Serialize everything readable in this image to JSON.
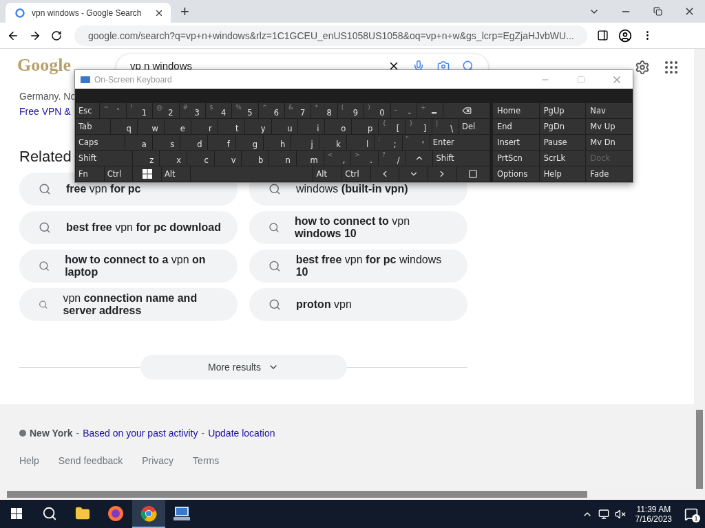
{
  "browser": {
    "tab": {
      "title": "vpn windows - Google Search",
      "selected": true
    },
    "new_tab": "+",
    "url": "google.com/search?q=vp+n+windows&rlz=1C1GCEU_enUS1058US1058&oq=vp+n+w&gs_lcrp=EgZjaHJvbWU..."
  },
  "google": {
    "logo": "Google",
    "query": "vp n windows"
  },
  "snippet": {
    "text": "Germany. No",
    "link": "Free VPN &"
  },
  "related": {
    "heading": "Related",
    "items": [
      {
        "text": "**free** vpn **for pc**"
      },
      {
        "text": "windows **(built-in vpn)**"
      },
      {
        "text": "**best free** vpn **for pc download**"
      },
      {
        "text": "**how to connect to** vpn **windows 10**"
      },
      {
        "text": "**how to connect to a** vpn **on laptop**"
      },
      {
        "text": "**best free** vpn **for pc** windows **10**"
      },
      {
        "text": "vpn **connection name and server address**"
      },
      {
        "text": "**proton** vpn"
      }
    ]
  },
  "more_results": "More results",
  "footer": {
    "location_line": [
      {
        "kind": "place",
        "text": "New York"
      },
      {
        "kind": "sep",
        "text": "-"
      },
      {
        "kind": "link",
        "text": "Based on your past activity"
      },
      {
        "kind": "sep",
        "text": "-"
      },
      {
        "kind": "link",
        "text": "Update location"
      }
    ],
    "links": [
      "Help",
      "Send feedback",
      "Privacy",
      "Terms"
    ]
  },
  "keyboard": {
    "title": "On-Screen Keyboard",
    "rows": [
      {
        "keys": [
          {
            "kind": "esc",
            "label": "Esc"
          },
          {
            "kind": "char",
            "shift": "~",
            "label": "`"
          },
          {
            "kind": "char",
            "shift": "!",
            "label": "1"
          },
          {
            "kind": "char",
            "shift": "@",
            "label": "2"
          },
          {
            "kind": "char",
            "shift": "#",
            "label": "3"
          },
          {
            "kind": "char",
            "shift": "$",
            "label": "4"
          },
          {
            "kind": "char",
            "shift": "%",
            "label": "5"
          },
          {
            "kind": "char",
            "shift": "^",
            "label": "6"
          },
          {
            "kind": "char",
            "shift": "&",
            "label": "7"
          },
          {
            "kind": "char",
            "shift": "*",
            "label": "8"
          },
          {
            "kind": "char",
            "shift": "(",
            "label": "9"
          },
          {
            "kind": "char",
            "shift": ")",
            "label": "0"
          },
          {
            "kind": "char",
            "shift": "_",
            "label": "-"
          },
          {
            "kind": "char",
            "shift": "+",
            "label": "="
          },
          {
            "kind": "backspace"
          }
        ]
      },
      {
        "keys": [
          {
            "kind": "tab",
            "label": "Tab"
          },
          {
            "kind": "char",
            "label": "q"
          },
          {
            "kind": "char",
            "label": "w"
          },
          {
            "kind": "char",
            "label": "e"
          },
          {
            "kind": "char",
            "label": "r"
          },
          {
            "kind": "char",
            "label": "t"
          },
          {
            "kind": "char",
            "label": "y"
          },
          {
            "kind": "char",
            "label": "u"
          },
          {
            "kind": "char",
            "label": "i"
          },
          {
            "kind": "char",
            "label": "o"
          },
          {
            "kind": "char",
            "label": "p"
          },
          {
            "kind": "char",
            "shift": "{",
            "label": "["
          },
          {
            "kind": "char",
            "shift": "}",
            "label": "]"
          },
          {
            "kind": "char",
            "shift": "|",
            "label": "\\"
          },
          {
            "kind": "del",
            "label": "Del"
          }
        ]
      },
      {
        "keys": [
          {
            "kind": "caps",
            "label": "Caps"
          },
          {
            "kind": "char",
            "label": "a"
          },
          {
            "kind": "char",
            "label": "s"
          },
          {
            "kind": "char",
            "label": "d"
          },
          {
            "kind": "char",
            "label": "f"
          },
          {
            "kind": "char",
            "label": "g"
          },
          {
            "kind": "char",
            "label": "h"
          },
          {
            "kind": "char",
            "label": "j"
          },
          {
            "kind": "char",
            "label": "k"
          },
          {
            "kind": "char",
            "label": "l"
          },
          {
            "kind": "char",
            "shift": ":",
            "label": ";"
          },
          {
            "kind": "char",
            "shift": "\"",
            "label": "'"
          },
          {
            "kind": "enter",
            "label": "Enter"
          }
        ]
      },
      {
        "keys": [
          {
            "kind": "shift",
            "label": "Shift"
          },
          {
            "kind": "char",
            "label": "z"
          },
          {
            "kind": "char",
            "label": "x"
          },
          {
            "kind": "char",
            "label": "c"
          },
          {
            "kind": "char",
            "label": "v"
          },
          {
            "kind": "char",
            "label": "b"
          },
          {
            "kind": "char",
            "label": "n"
          },
          {
            "kind": "char",
            "label": "m"
          },
          {
            "kind": "char",
            "shift": "<",
            "label": ","
          },
          {
            "kind": "char",
            "shift": ">",
            "label": "."
          },
          {
            "kind": "char",
            "shift": "?",
            "label": "/"
          },
          {
            "kind": "up"
          },
          {
            "kind": "shift",
            "label": "Shift"
          }
        ]
      },
      {
        "keys": [
          {
            "kind": "mod",
            "label": "Fn"
          },
          {
            "kind": "mod",
            "label": "Ctrl"
          },
          {
            "kind": "windows"
          },
          {
            "kind": "mod",
            "label": "Alt"
          },
          {
            "kind": "space"
          },
          {
            "kind": "mod",
            "label": "Alt"
          },
          {
            "kind": "mod",
            "label": "Ctrl"
          },
          {
            "kind": "left"
          },
          {
            "kind": "down"
          },
          {
            "kind": "right"
          },
          {
            "kind": "menu"
          }
        ]
      }
    ],
    "nav": [
      [
        {
          "label": "Home",
          "disabled": false
        },
        {
          "label": "PgUp",
          "disabled": false
        },
        {
          "label": "Nav",
          "disabled": false
        }
      ],
      [
        {
          "label": "End",
          "disabled": false
        },
        {
          "label": "PgDn",
          "disabled": false
        },
        {
          "label": "Mv Up",
          "disabled": false
        }
      ],
      [
        {
          "label": "Insert",
          "disabled": false
        },
        {
          "label": "Pause",
          "disabled": false
        },
        {
          "label": "Mv Dn",
          "disabled": false
        }
      ],
      [
        {
          "label": "PrtScn",
          "disabled": false
        },
        {
          "label": "ScrLk",
          "disabled": false
        },
        {
          "label": "Dock",
          "disabled": true
        }
      ],
      [
        {
          "label": "Options",
          "disabled": false
        },
        {
          "label": "Help",
          "disabled": false
        },
        {
          "label": "Fade",
          "disabled": false
        }
      ]
    ]
  },
  "taskbar": {
    "apps": [
      {
        "kind": "explorer",
        "selected": false
      },
      {
        "kind": "firefox",
        "selected": false
      },
      {
        "kind": "chrome",
        "selected": true
      },
      {
        "kind": "keyboard",
        "selected": false
      }
    ],
    "time": "11:39 AM",
    "date": "7/16/2023",
    "notifications": "1"
  }
}
